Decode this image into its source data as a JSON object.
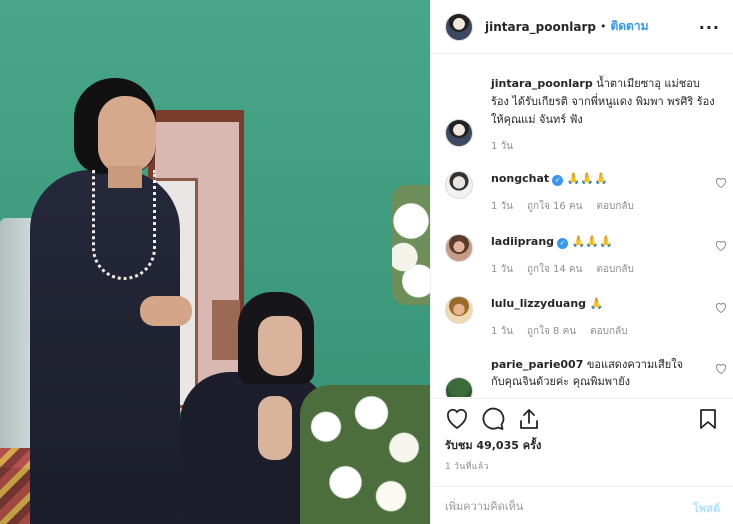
{
  "post": {
    "username": "jintara_poonlarp",
    "follow_label": "ติดตาม",
    "separator": "•",
    "more_label": "···",
    "caption_username": "jintara_poonlarp",
    "caption_text": "น้ำตาเมียซาอุ แม่ชอบร้อง ได้รับเกียรติ จากพี่หนูแดง พิมพา พรศิริ ร้องให้คุณแม่ จันทร์ ฟัง",
    "caption_time": "1 วัน",
    "likes_text": "รับชม 49,035 ครั้ง",
    "posted_time": "1 วันที่แล้ว"
  },
  "comments": [
    {
      "username": "nongchat",
      "verified": true,
      "text": "🙏🙏🙏",
      "time": "1 วัน",
      "likes": "ถูกใจ 16 คน",
      "reply": "ตอบกลับ"
    },
    {
      "username": "ladiiprang",
      "verified": true,
      "text": "🙏🙏🙏",
      "time": "1 วัน",
      "likes": "ถูกใจ 14 คน",
      "reply": "ตอบกลับ"
    },
    {
      "username": "lulu_lizzyduang",
      "verified": false,
      "text": "🙏",
      "time": "1 วัน",
      "likes": "ถูกใจ 8 คน",
      "reply": "ตอบกลับ"
    },
    {
      "username": "parie_parie007",
      "verified": false,
      "text": "ขอแสดงความเสียใจกับคุณจินด้วยค่ะ คุณพิมพายัง",
      "time": "",
      "likes": "",
      "reply": ""
    }
  ],
  "composer": {
    "placeholder": "เพิ่มความคิดเห็น",
    "post_label": "โพสต์"
  },
  "icons": {
    "like": "heart-icon",
    "comment": "comment-icon",
    "share": "share-icon",
    "save": "bookmark-icon",
    "verified": "verified-badge-icon"
  },
  "colors": {
    "accent": "#3897f0",
    "post_disabled": "#b2dffc",
    "meta_gray": "#8e8e8e"
  }
}
